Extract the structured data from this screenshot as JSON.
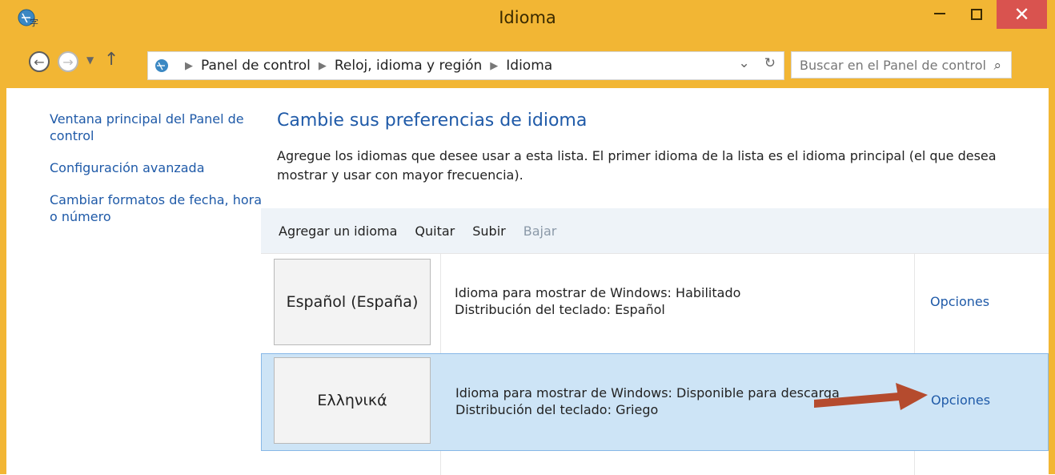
{
  "window": {
    "title": "Idioma",
    "close_symbol": "✕",
    "title_icon": "globe-language-icon",
    "accent_color": "#f2b634"
  },
  "address": {
    "crumbs": [
      "Panel de control",
      "Reloj, idioma y región",
      "Idioma"
    ],
    "search_placeholder": "Buscar en el Panel de control"
  },
  "sidebar": {
    "links": [
      "Ventana principal del Panel de control",
      "Configuración avanzada",
      "Cambiar formatos de fecha, hora o número"
    ]
  },
  "main": {
    "title": "Cambie sus preferencias de idioma",
    "description": "Agregue los idiomas que desee usar a esta lista. El primer idioma de la lista es el idioma principal (el que desea mostrar y usar con mayor frecuencia)."
  },
  "toolbar": {
    "add": "Agregar un idioma",
    "remove": "Quitar",
    "up": "Subir",
    "down": "Bajar"
  },
  "languages": [
    {
      "name": "Español (España)",
      "line1": "Idioma para mostrar de Windows: Habilitado",
      "line2": "Distribución del teclado: Español",
      "options": "Opciones"
    },
    {
      "name": "Ελληνικά",
      "line1": "Idioma para mostrar de Windows: Disponible para descarga",
      "line2": "Distribución del teclado: Griego",
      "options": "Opciones"
    }
  ]
}
